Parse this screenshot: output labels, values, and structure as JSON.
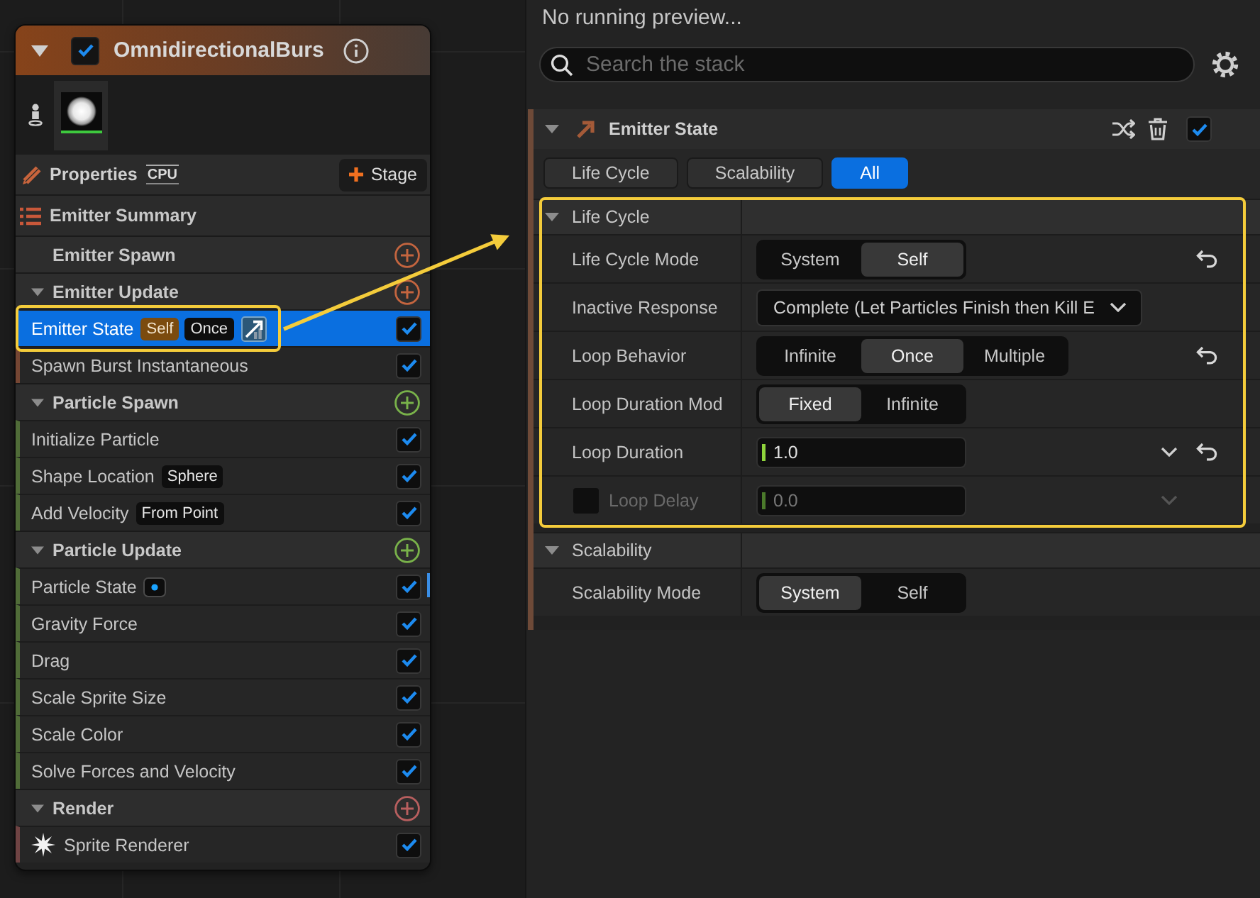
{
  "node": {
    "title": "OmnidirectionalBurs",
    "enabled": true,
    "preview": {
      "selected": true
    },
    "toolbar": {
      "properties": "Properties",
      "target": "CPU",
      "add_stage": "Stage"
    },
    "groups": [
      {
        "kind": "summary",
        "label": "Emitter Summary"
      },
      {
        "kind": "empty",
        "label": "Emitter Spawn",
        "color": "#c4653f"
      },
      {
        "kind": "stage",
        "label": "Emitter Update",
        "color": "#c4653f",
        "expanded": true,
        "items": [
          {
            "kind": "module",
            "label": "Emitter State",
            "selected": true,
            "highlighted": true,
            "enabled": true,
            "badges": [
              {
                "kind": "scope",
                "text": "Self"
              },
              {
                "kind": "value",
                "text": "Once"
              },
              {
                "kind": "graph"
              }
            ]
          },
          {
            "kind": "module",
            "label": "Spawn Burst Instantaneous",
            "selected": false,
            "highlighted": false,
            "enabled": true
          }
        ]
      },
      {
        "kind": "stage",
        "label": "Particle Spawn",
        "color": "#79b24a",
        "expanded": true,
        "items": [
          {
            "kind": "module",
            "label": "Initialize Particle",
            "selected": false,
            "highlighted": false,
            "enabled": true
          },
          {
            "kind": "module",
            "label": "Shape Location",
            "selected": false,
            "highlighted": false,
            "enabled": true,
            "badges": [
              {
                "kind": "value",
                "text": "Sphere"
              }
            ]
          },
          {
            "kind": "module",
            "label": "Add Velocity",
            "selected": false,
            "highlighted": false,
            "enabled": true,
            "badges": [
              {
                "kind": "value",
                "text": "From Point"
              }
            ]
          }
        ]
      },
      {
        "kind": "stage",
        "label": "Particle Update",
        "color": "#79b24a",
        "expanded": true,
        "items": [
          {
            "kind": "module",
            "label": "Particle State",
            "selected": false,
            "highlighted": false,
            "enabled": true,
            "badges": [
              {
                "kind": "dot"
              }
            ]
          },
          {
            "kind": "module",
            "label": "Gravity Force",
            "selected": false,
            "highlighted": false,
            "enabled": true
          },
          {
            "kind": "module",
            "label": "Drag",
            "selected": false,
            "highlighted": false,
            "enabled": true
          },
          {
            "kind": "module",
            "label": "Scale Sprite Size",
            "selected": false,
            "highlighted": false,
            "enabled": true
          },
          {
            "kind": "module",
            "label": "Scale Color",
            "selected": false,
            "highlighted": false,
            "enabled": true
          },
          {
            "kind": "module",
            "label": "Solve Forces and Velocity",
            "selected": false,
            "highlighted": false,
            "enabled": true
          }
        ]
      },
      {
        "kind": "stage",
        "label": "Render",
        "color": "#b85f5f",
        "expanded": true,
        "items": [
          {
            "kind": "renderer",
            "label": "Sprite Renderer",
            "selected": false,
            "highlighted": false,
            "enabled": true
          }
        ]
      }
    ]
  },
  "preview_status": "No running preview...",
  "search": {
    "placeholder": "Search the stack"
  },
  "module": {
    "title": "Emitter State",
    "expanded": true,
    "enabled": true,
    "filters": [
      {
        "label": "Life Cycle",
        "selected": false
      },
      {
        "label": "Scalability",
        "selected": false
      },
      {
        "label": "All",
        "selected": true
      }
    ],
    "sections": [
      {
        "title": "Life Cycle",
        "expanded": true,
        "highlighted": true,
        "rows": [
          {
            "kind": "segmented",
            "label": "Life Cycle Mode",
            "disabled": false,
            "reset": true,
            "options": [
              {
                "label": "System",
                "selected": false
              },
              {
                "label": "Self",
                "selected": true
              }
            ]
          },
          {
            "kind": "dropdown",
            "label": "Inactive Response",
            "disabled": false,
            "reset": false,
            "value": "Complete (Let Particles Finish then Kill E"
          },
          {
            "kind": "segmented",
            "label": "Loop Behavior",
            "disabled": false,
            "reset": true,
            "options": [
              {
                "label": "Infinite",
                "selected": false
              },
              {
                "label": "Once",
                "selected": true
              },
              {
                "label": "Multiple",
                "selected": false
              }
            ]
          },
          {
            "kind": "segmented",
            "label": "Loop Duration Mod",
            "disabled": false,
            "reset": false,
            "options": [
              {
                "label": "Fixed",
                "selected": true
              },
              {
                "label": "Infinite",
                "selected": false
              }
            ]
          },
          {
            "kind": "number",
            "label": "Loop Duration",
            "disabled": false,
            "reset": true,
            "value": "1.0"
          },
          {
            "kind": "number",
            "label": "Loop Delay",
            "disabled": true,
            "reset": false,
            "value": "0.0",
            "condition": {
              "checked": false
            }
          }
        ]
      },
      {
        "title": "Scalability",
        "expanded": true,
        "highlighted": false,
        "rows": [
          {
            "kind": "segmented",
            "label": "Scalability Mode",
            "disabled": false,
            "reset": false,
            "options": [
              {
                "label": "System",
                "selected": true
              },
              {
                "label": "Self",
                "selected": false
              }
            ]
          }
        ]
      }
    ]
  }
}
